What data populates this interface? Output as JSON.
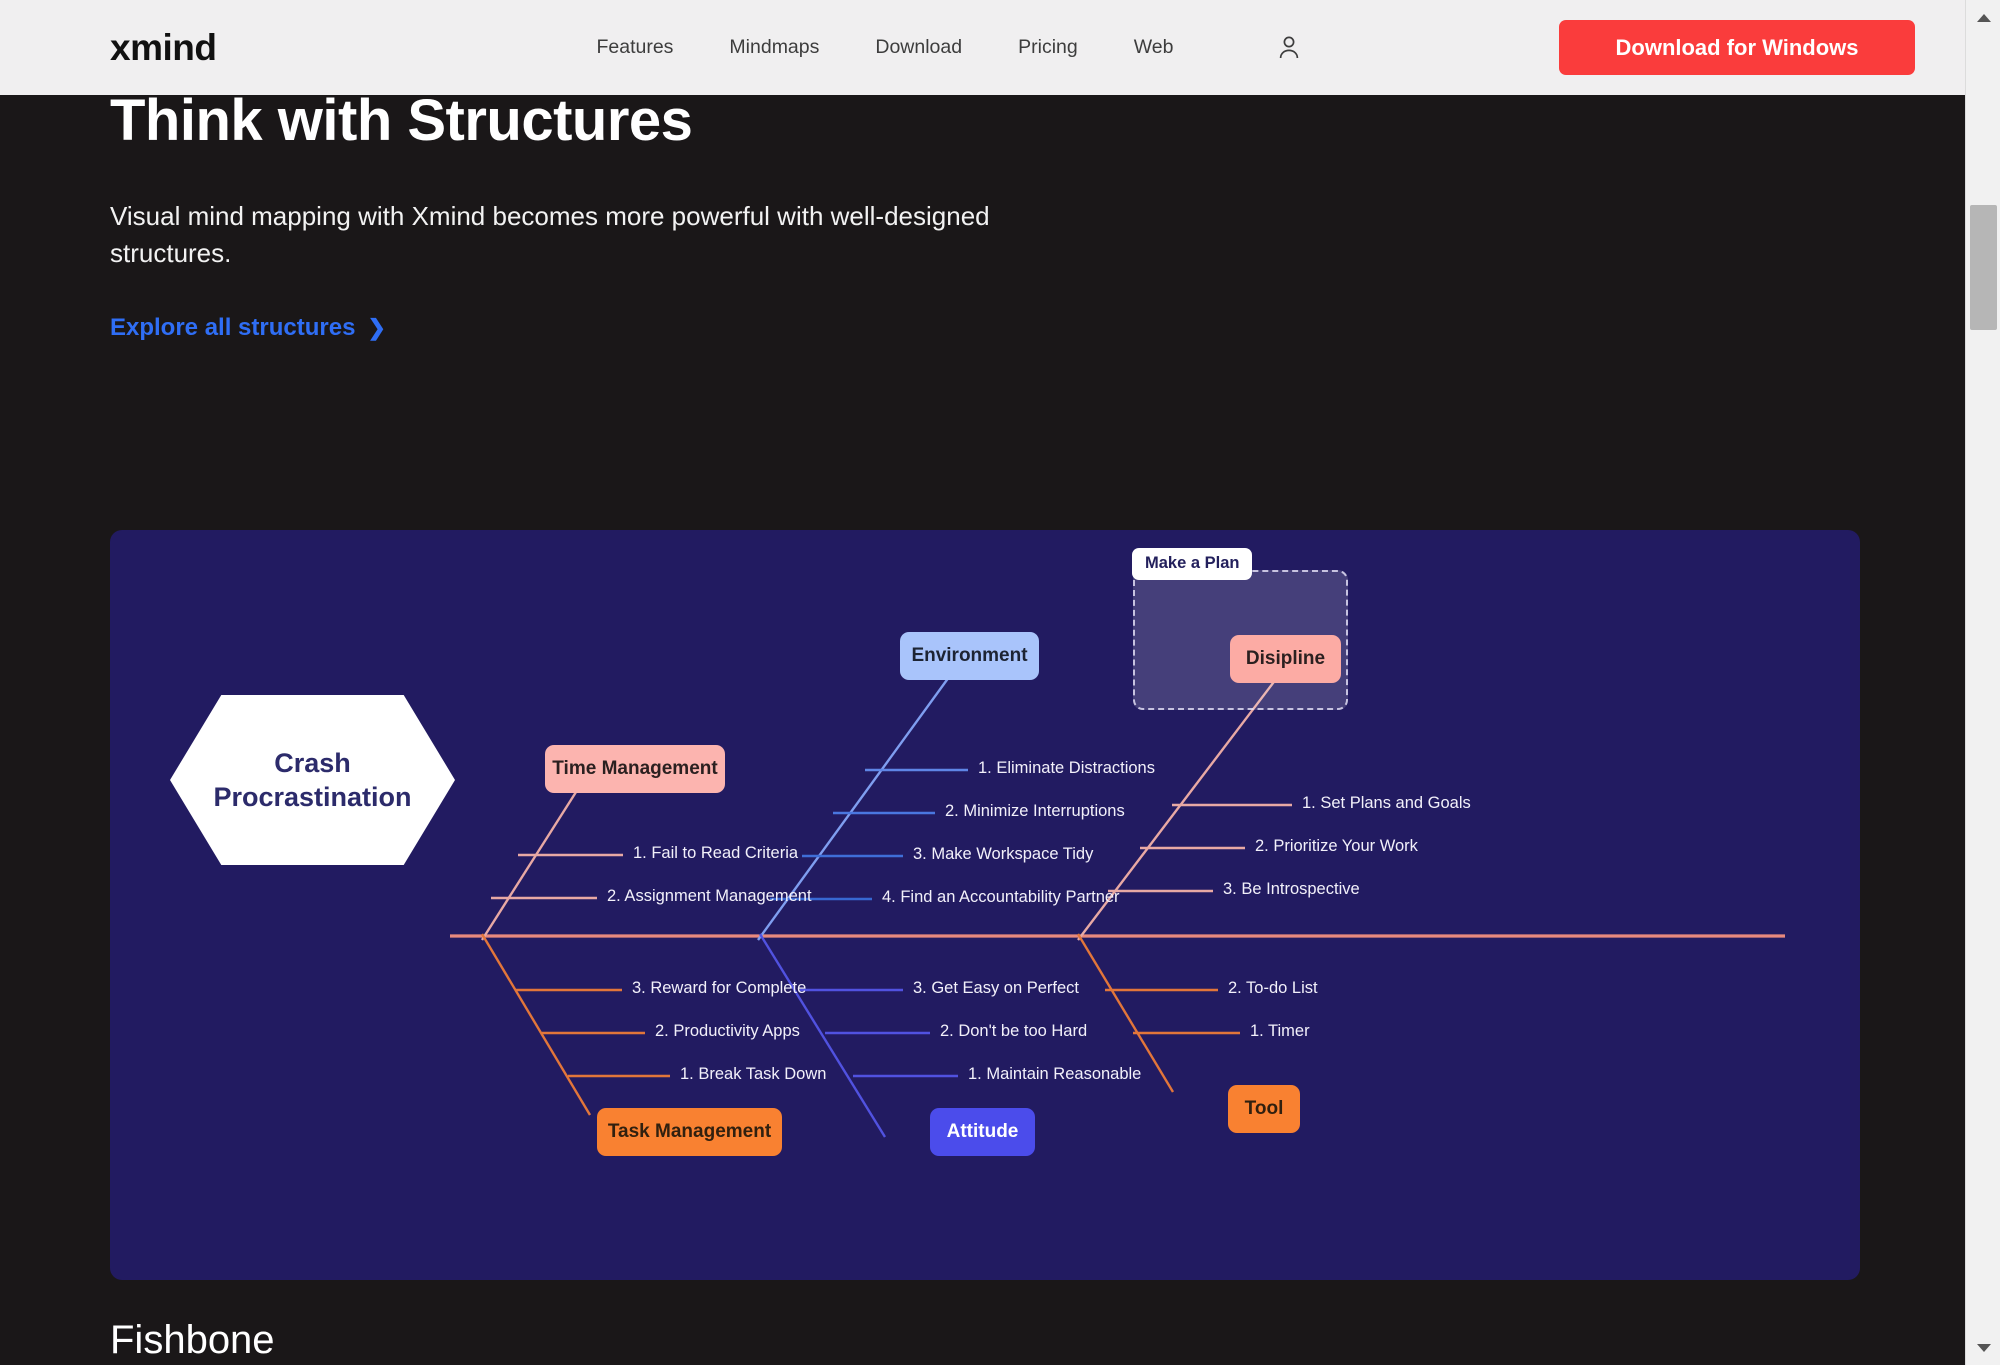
{
  "nav": {
    "logo": "xmind",
    "links": [
      "Features",
      "Mindmaps",
      "Download",
      "Pricing",
      "Web"
    ],
    "account_icon": "person-icon",
    "cta_label": "Download for Windows",
    "cta_color": "#fa3c3c",
    "bg_color": "#f0eff0"
  },
  "hero": {
    "title": "Think with Structures",
    "subtitle": "Visual mind mapping with Xmind becomes more powerful with well-designed structures.",
    "link_label": "Explore all structures",
    "link_chevron": "❯",
    "link_color": "#2f6ef5"
  },
  "section": {
    "title": "Fishbone"
  },
  "scrollbar": {
    "up_icon": "triangle-up-icon",
    "down_icon": "triangle-down-icon",
    "thumb": "scrollbar-thumb"
  },
  "chart_data": {
    "type": "diagram",
    "diagram_type": "fishbone",
    "title": "Crash Procrastination",
    "card_bg": "#221b61",
    "spine_color": "#e8897e",
    "center": {
      "label": "Crash Procrastination",
      "bg": "#ffffff",
      "text": "#2c2b6b"
    },
    "selection": {
      "label": "Make a Plan",
      "parent": "Disipline",
      "style": "dashed-highlight",
      "fill": "rgba(255,255,255,0.16)",
      "border": "rgba(233,229,250,0.8)"
    },
    "branches": [
      {
        "label": "Time Management",
        "side": "top",
        "bg": "#fcb4af",
        "text": "#2b2020",
        "bone_color": "#e8a9a4",
        "children": [
          "1. Fail to Read Criteria",
          "2. Assignment Management"
        ]
      },
      {
        "label": "Environment",
        "side": "top",
        "bg": "#a9c4fb",
        "text": "#1d2433",
        "bone_color": "#7f9ef0",
        "children": [
          "1. Eliminate Distractions",
          "2. Minimize Interruptions",
          "3. Make Workspace Tidy",
          "4. Find an Accountability Partner"
        ]
      },
      {
        "label": "Disipline",
        "side": "top",
        "bg": "#fcaba4",
        "text": "#2b2020",
        "bone_color": "#e8a9a4",
        "children": [
          "1. Set Plans and Goals",
          "2. Prioritize Your Work",
          "3. Be Introspective"
        ]
      },
      {
        "label": "Task Management",
        "side": "bottom",
        "bg": "#f98131",
        "text": "#31200f",
        "bone_color": "#e2763a",
        "children": [
          "3. Reward for Complete",
          "2. Productivity Apps",
          "1. Break Task Down"
        ]
      },
      {
        "label": "Attitude",
        "side": "bottom",
        "bg": "#4b4ceb",
        "text": "#ffffff",
        "bone_color": "#5152e0",
        "children": [
          "3. Get Easy on Perfect",
          "2. Don't be too Hard",
          "1. Maintain Reasonable"
        ]
      },
      {
        "label": "Tool",
        "side": "bottom",
        "bg": "#f98131",
        "text": "#31200f",
        "bone_color": "#e2763a",
        "children": [
          "2. To-do List",
          "1. Timer"
        ]
      }
    ]
  }
}
